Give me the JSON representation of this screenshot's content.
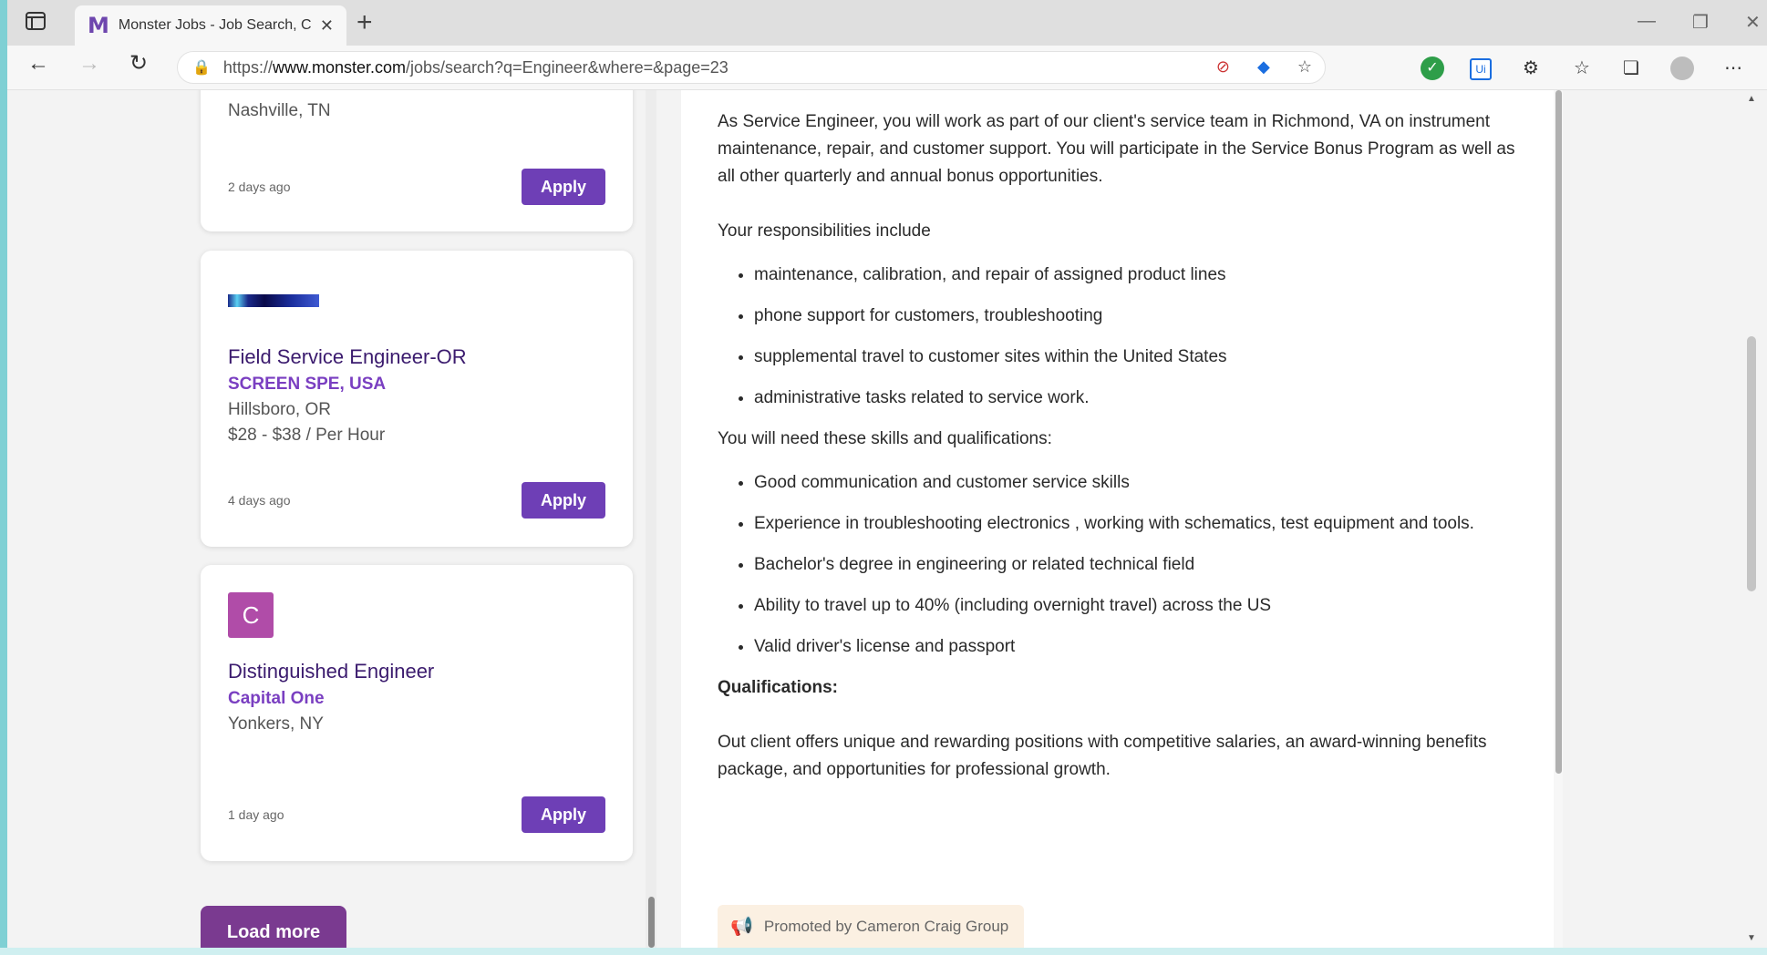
{
  "browser": {
    "tab_title": "Monster Jobs - Job Search, Care",
    "favicon": "M",
    "new_tab": "+",
    "url_prefix": "https://",
    "url_domain": "www.monster.com",
    "url_path": "/jobs/search?q=Engineer&where=&page=23"
  },
  "job_cards": [
    {
      "location": "Nashville, TN",
      "posted": "2 days ago",
      "apply_label": "Apply"
    },
    {
      "logo_text": "SCREEN",
      "title": "Field Service Engineer-OR",
      "company": "SCREEN SPE, USA",
      "location": "Hillsboro, OR",
      "pay": "$28 - $38 / Per Hour",
      "posted": "4 days ago",
      "apply_label": "Apply"
    },
    {
      "logo_letter": "C",
      "title": "Distinguished Engineer",
      "company": "Capital One",
      "location": "Yonkers, NY",
      "posted": "1 day ago",
      "apply_label": "Apply"
    }
  ],
  "load_more_label": "Load more",
  "detail": {
    "intro": "As Service Engineer, you will work as part of our client's service team in Richmond, VA on instrument maintenance, repair, and customer support. You will participate in the Service Bonus Program as well as all other quarterly and annual bonus opportunities.",
    "responsibilities_heading": "Your responsibilities include",
    "responsibilities": [
      "maintenance, calibration, and repair of assigned product lines",
      "phone support for customers, troubleshooting",
      "supplemental travel to customer sites within the United States",
      "administrative tasks related to service work."
    ],
    "skills_heading": "You will need these skills and qualifications:",
    "skills": [
      "Good communication and customer service skills",
      "Experience in troubleshooting electronics , working with schematics, test equipment and tools.",
      "Bachelor's degree in engineering or related technical field",
      "Ability to travel up to 40% (including overnight travel) across the US",
      "Valid driver's license and passport"
    ],
    "qualifications_heading": "Qualifications:",
    "closing": "Out client offers unique and rewarding positions with competitive salaries, an award-winning benefits package, and opportunities for professional growth.",
    "promoted": "Promoted by Cameron Craig Group"
  }
}
